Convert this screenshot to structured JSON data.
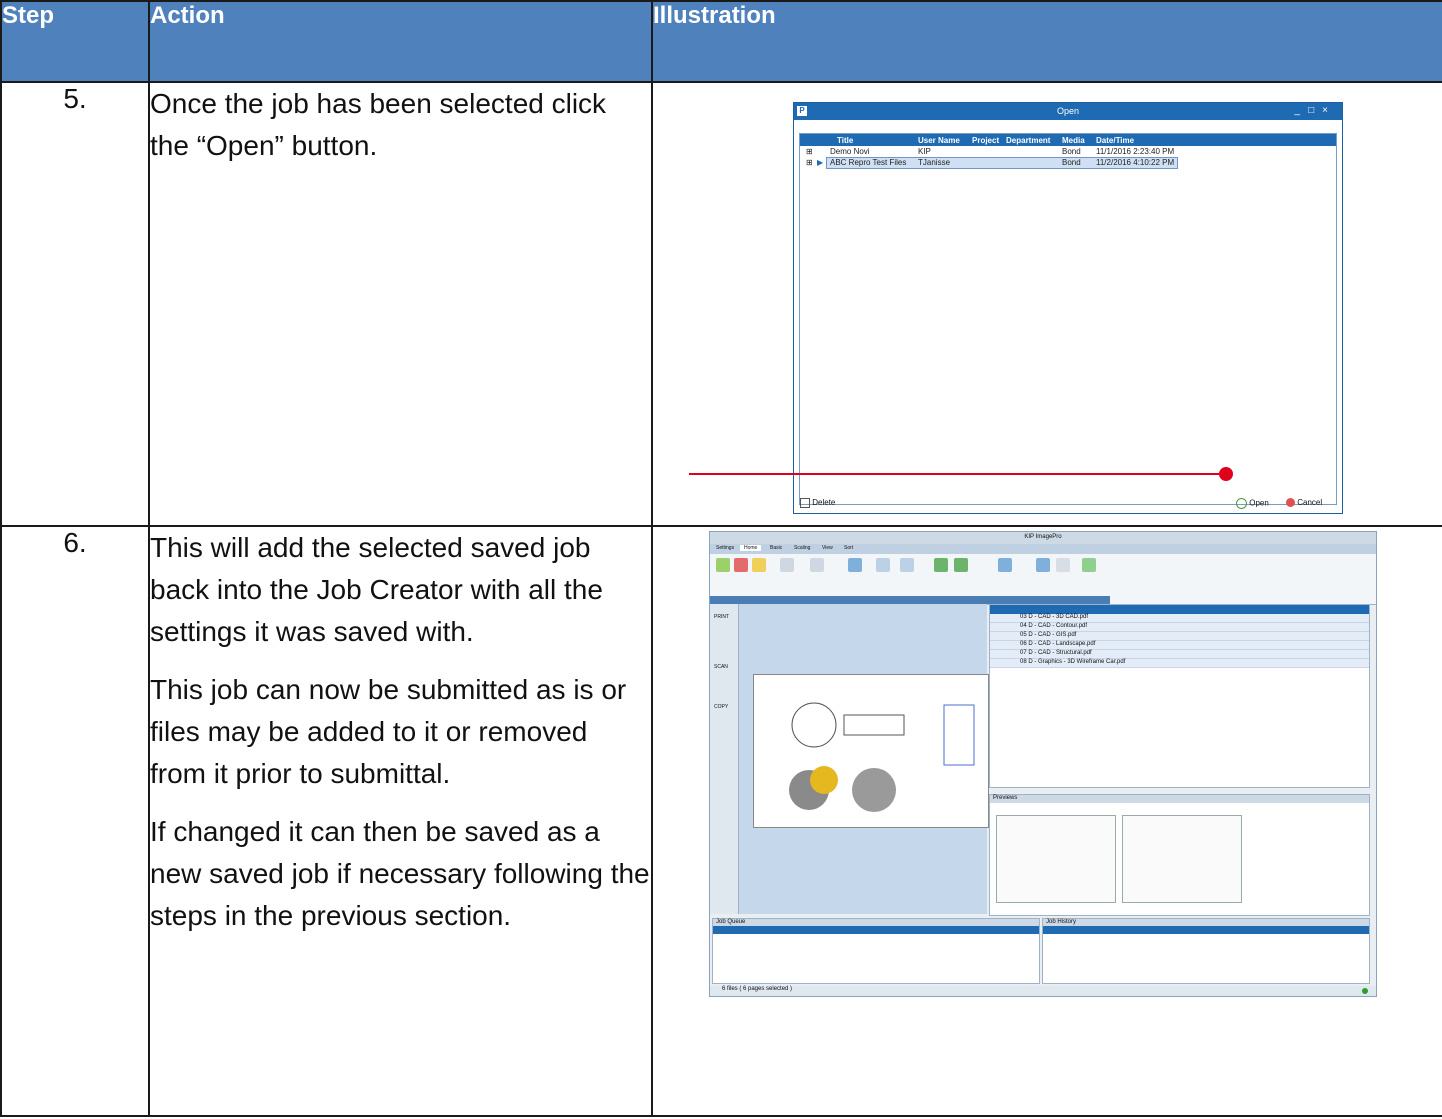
{
  "table": {
    "headers": {
      "step": "Step",
      "action": "Action",
      "illustration": "Illustration"
    },
    "rows": [
      {
        "step": "5.",
        "paragraphs": [
          "Once the job has been selected click the “Open” button."
        ]
      },
      {
        "step": "6.",
        "paragraphs": [
          "This will add the selected saved job back into the Job Creator with all the settings it was saved with.",
          "This job can now be submitted as is or files may be added to it or removed from it prior to submittal.",
          "If changed it can then be saved as a new saved job if necessary following the steps in the previous section."
        ]
      }
    ]
  },
  "open_dialog": {
    "title": "Open",
    "columns": [
      "Title",
      "User Name",
      "Project",
      "Department",
      "Media",
      "Date/Time"
    ],
    "rows": [
      {
        "title": "Demo Novi",
        "user": "KIP",
        "media": "Bond",
        "datetime": "11/1/2016 2:23:40 PM"
      },
      {
        "title": "ABC Repro Test Files",
        "user": "TJanisse",
        "media": "Bond",
        "datetime": "11/2/2016 4:10:22 PM"
      }
    ],
    "delete_label": "Delete",
    "open_label": "Open",
    "cancel_label": "Cancel"
  },
  "kip": {
    "title": "KIP ImagePro",
    "tabs": [
      "Settings",
      "Home",
      "Basic",
      "Scaling",
      "View",
      "Sort"
    ],
    "side": [
      "PRINT",
      "SCAN",
      "COPY"
    ],
    "files": [
      "03 D - CAD - 3D CAD.pdf",
      "04 D - CAD - Contour.pdf",
      "05 D - CAD - GIS.pdf",
      "06 D - CAD - Landscape.pdf",
      "07 D - CAD - Structural.pdf",
      "08 D - Graphics - 3D Wireframe Car.pdf"
    ],
    "previews_label": "Previews",
    "job_queue_label": "Job Queue",
    "job_history_label": "Job History",
    "status": "6 files  ( 6 pages selected )"
  },
  "colors": {
    "header_blue": "#4f81bd",
    "callout_red": "#e0001b",
    "dialog_blue": "#1f6bb3"
  }
}
